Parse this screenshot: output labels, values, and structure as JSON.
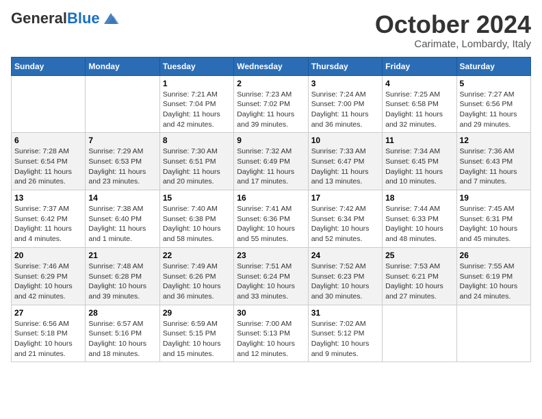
{
  "header": {
    "logo_general": "General",
    "logo_blue": "Blue",
    "month": "October 2024",
    "location": "Carimate, Lombardy, Italy"
  },
  "weekdays": [
    "Sunday",
    "Monday",
    "Tuesday",
    "Wednesday",
    "Thursday",
    "Friday",
    "Saturday"
  ],
  "weeks": [
    [
      {
        "day": "",
        "sunrise": "",
        "sunset": "",
        "daylight": ""
      },
      {
        "day": "",
        "sunrise": "",
        "sunset": "",
        "daylight": ""
      },
      {
        "day": "1",
        "sunrise": "Sunrise: 7:21 AM",
        "sunset": "Sunset: 7:04 PM",
        "daylight": "Daylight: 11 hours and 42 minutes."
      },
      {
        "day": "2",
        "sunrise": "Sunrise: 7:23 AM",
        "sunset": "Sunset: 7:02 PM",
        "daylight": "Daylight: 11 hours and 39 minutes."
      },
      {
        "day": "3",
        "sunrise": "Sunrise: 7:24 AM",
        "sunset": "Sunset: 7:00 PM",
        "daylight": "Daylight: 11 hours and 36 minutes."
      },
      {
        "day": "4",
        "sunrise": "Sunrise: 7:25 AM",
        "sunset": "Sunset: 6:58 PM",
        "daylight": "Daylight: 11 hours and 32 minutes."
      },
      {
        "day": "5",
        "sunrise": "Sunrise: 7:27 AM",
        "sunset": "Sunset: 6:56 PM",
        "daylight": "Daylight: 11 hours and 29 minutes."
      }
    ],
    [
      {
        "day": "6",
        "sunrise": "Sunrise: 7:28 AM",
        "sunset": "Sunset: 6:54 PM",
        "daylight": "Daylight: 11 hours and 26 minutes."
      },
      {
        "day": "7",
        "sunrise": "Sunrise: 7:29 AM",
        "sunset": "Sunset: 6:53 PM",
        "daylight": "Daylight: 11 hours and 23 minutes."
      },
      {
        "day": "8",
        "sunrise": "Sunrise: 7:30 AM",
        "sunset": "Sunset: 6:51 PM",
        "daylight": "Daylight: 11 hours and 20 minutes."
      },
      {
        "day": "9",
        "sunrise": "Sunrise: 7:32 AM",
        "sunset": "Sunset: 6:49 PM",
        "daylight": "Daylight: 11 hours and 17 minutes."
      },
      {
        "day": "10",
        "sunrise": "Sunrise: 7:33 AM",
        "sunset": "Sunset: 6:47 PM",
        "daylight": "Daylight: 11 hours and 13 minutes."
      },
      {
        "day": "11",
        "sunrise": "Sunrise: 7:34 AM",
        "sunset": "Sunset: 6:45 PM",
        "daylight": "Daylight: 11 hours and 10 minutes."
      },
      {
        "day": "12",
        "sunrise": "Sunrise: 7:36 AM",
        "sunset": "Sunset: 6:43 PM",
        "daylight": "Daylight: 11 hours and 7 minutes."
      }
    ],
    [
      {
        "day": "13",
        "sunrise": "Sunrise: 7:37 AM",
        "sunset": "Sunset: 6:42 PM",
        "daylight": "Daylight: 11 hours and 4 minutes."
      },
      {
        "day": "14",
        "sunrise": "Sunrise: 7:38 AM",
        "sunset": "Sunset: 6:40 PM",
        "daylight": "Daylight: 11 hours and 1 minute."
      },
      {
        "day": "15",
        "sunrise": "Sunrise: 7:40 AM",
        "sunset": "Sunset: 6:38 PM",
        "daylight": "Daylight: 10 hours and 58 minutes."
      },
      {
        "day": "16",
        "sunrise": "Sunrise: 7:41 AM",
        "sunset": "Sunset: 6:36 PM",
        "daylight": "Daylight: 10 hours and 55 minutes."
      },
      {
        "day": "17",
        "sunrise": "Sunrise: 7:42 AM",
        "sunset": "Sunset: 6:34 PM",
        "daylight": "Daylight: 10 hours and 52 minutes."
      },
      {
        "day": "18",
        "sunrise": "Sunrise: 7:44 AM",
        "sunset": "Sunset: 6:33 PM",
        "daylight": "Daylight: 10 hours and 48 minutes."
      },
      {
        "day": "19",
        "sunrise": "Sunrise: 7:45 AM",
        "sunset": "Sunset: 6:31 PM",
        "daylight": "Daylight: 10 hours and 45 minutes."
      }
    ],
    [
      {
        "day": "20",
        "sunrise": "Sunrise: 7:46 AM",
        "sunset": "Sunset: 6:29 PM",
        "daylight": "Daylight: 10 hours and 42 minutes."
      },
      {
        "day": "21",
        "sunrise": "Sunrise: 7:48 AM",
        "sunset": "Sunset: 6:28 PM",
        "daylight": "Daylight: 10 hours and 39 minutes."
      },
      {
        "day": "22",
        "sunrise": "Sunrise: 7:49 AM",
        "sunset": "Sunset: 6:26 PM",
        "daylight": "Daylight: 10 hours and 36 minutes."
      },
      {
        "day": "23",
        "sunrise": "Sunrise: 7:51 AM",
        "sunset": "Sunset: 6:24 PM",
        "daylight": "Daylight: 10 hours and 33 minutes."
      },
      {
        "day": "24",
        "sunrise": "Sunrise: 7:52 AM",
        "sunset": "Sunset: 6:23 PM",
        "daylight": "Daylight: 10 hours and 30 minutes."
      },
      {
        "day": "25",
        "sunrise": "Sunrise: 7:53 AM",
        "sunset": "Sunset: 6:21 PM",
        "daylight": "Daylight: 10 hours and 27 minutes."
      },
      {
        "day": "26",
        "sunrise": "Sunrise: 7:55 AM",
        "sunset": "Sunset: 6:19 PM",
        "daylight": "Daylight: 10 hours and 24 minutes."
      }
    ],
    [
      {
        "day": "27",
        "sunrise": "Sunrise: 6:56 AM",
        "sunset": "Sunset: 5:18 PM",
        "daylight": "Daylight: 10 hours and 21 minutes."
      },
      {
        "day": "28",
        "sunrise": "Sunrise: 6:57 AM",
        "sunset": "Sunset: 5:16 PM",
        "daylight": "Daylight: 10 hours and 18 minutes."
      },
      {
        "day": "29",
        "sunrise": "Sunrise: 6:59 AM",
        "sunset": "Sunset: 5:15 PM",
        "daylight": "Daylight: 10 hours and 15 minutes."
      },
      {
        "day": "30",
        "sunrise": "Sunrise: 7:00 AM",
        "sunset": "Sunset: 5:13 PM",
        "daylight": "Daylight: 10 hours and 12 minutes."
      },
      {
        "day": "31",
        "sunrise": "Sunrise: 7:02 AM",
        "sunset": "Sunset: 5:12 PM",
        "daylight": "Daylight: 10 hours and 9 minutes."
      },
      {
        "day": "",
        "sunrise": "",
        "sunset": "",
        "daylight": ""
      },
      {
        "day": "",
        "sunrise": "",
        "sunset": "",
        "daylight": ""
      }
    ]
  ]
}
